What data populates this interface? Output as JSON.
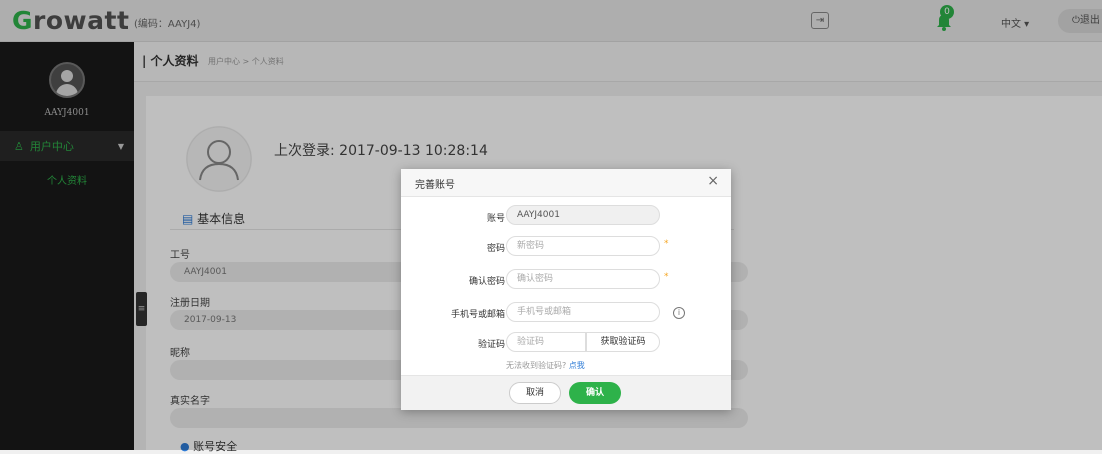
{
  "topbar": {
    "logo": "Growatt",
    "code_text": "(编码：AAYJ4)",
    "notifications_count": "0",
    "language": "中文 ▾",
    "logout": "⏻退出"
  },
  "sidebar": {
    "username": "AAYJ4001",
    "menu_label": "用户中心",
    "submenu_label": "个人资料"
  },
  "main": {
    "title": "| 个人资料",
    "breadcrumb": "用户中心 > 个人资料",
    "last_login": "上次登录: 2017-09-13 10:28:14",
    "section_title": "基本信息",
    "fields": [
      {
        "label": "工号",
        "value": "AAYJ4001"
      },
      {
        "label": "注册日期",
        "value": "2017-09-13"
      },
      {
        "label": "昵称",
        "value": ""
      },
      {
        "label": "真实名字",
        "value": ""
      }
    ],
    "next_section": "账号安全"
  },
  "modal": {
    "title": "完善账号",
    "account_label": "账号",
    "account_value": "AAYJ4001",
    "password_label": "密码",
    "password_placeholder": "新密码",
    "confirm_label": "确认密码",
    "confirm_placeholder": "确认密码",
    "contact_label": "手机号或邮箱",
    "contact_placeholder": "手机号或邮箱",
    "code_label": "验证码",
    "code_placeholder": "验证码",
    "get_code": "获取验证码",
    "hint_text": "无法收到验证码?",
    "hint_link": "点我",
    "cancel": "取消",
    "confirm": "确认"
  },
  "colors": {
    "accent": "#2eb24a",
    "sidebar_bg": "#1a1a1a"
  }
}
